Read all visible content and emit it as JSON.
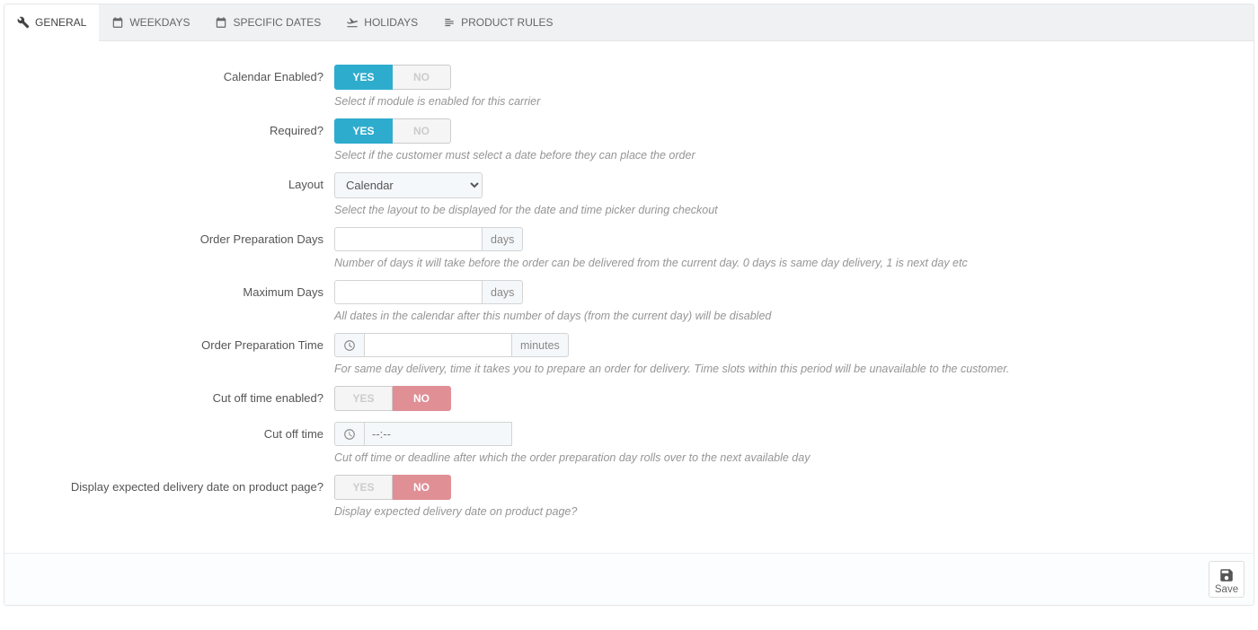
{
  "tabs": {
    "general": "GENERAL",
    "weekdays": "WEEKDAYS",
    "specific_dates": "SPECIFIC DATES",
    "holidays": "HOLIDAYS",
    "product_rules": "PRODUCT RULES"
  },
  "toggle": {
    "yes": "YES",
    "no": "NO"
  },
  "fields": {
    "calendar_enabled": {
      "label": "Calendar Enabled?",
      "help": "Select if module is enabled for this carrier",
      "value": "yes"
    },
    "required": {
      "label": "Required?",
      "help": "Select if the customer must select a date before they can place the order",
      "value": "yes"
    },
    "layout": {
      "label": "Layout",
      "help": "Select the layout to be displayed for the date and time picker during checkout",
      "value": "Calendar"
    },
    "order_prep_days": {
      "label": "Order Preparation Days",
      "help": "Number of days it will take before the order can be delivered from the current day. 0 days is same day delivery, 1 is next day etc",
      "unit": "days",
      "value": ""
    },
    "max_days": {
      "label": "Maximum Days",
      "help": "All dates in the calendar after this number of days (from the current day) will be disabled",
      "unit": "days",
      "value": ""
    },
    "order_prep_time": {
      "label": "Order Preparation Time",
      "help": "For same day delivery, time it takes you to prepare an order for delivery. Time slots within this period will be unavailable to the customer.",
      "unit": "minutes",
      "value": ""
    },
    "cutoff_enabled": {
      "label": "Cut off time enabled?",
      "value": "no"
    },
    "cutoff_time": {
      "label": "Cut off time",
      "help": "Cut off time or deadline after which the order preparation day rolls over to the next available day",
      "placeholder": "--:--",
      "value": ""
    },
    "display_expected": {
      "label": "Display expected delivery date on product page?",
      "help": "Display expected delivery date on product page?",
      "value": "no"
    }
  },
  "footer": {
    "save": "Save"
  }
}
